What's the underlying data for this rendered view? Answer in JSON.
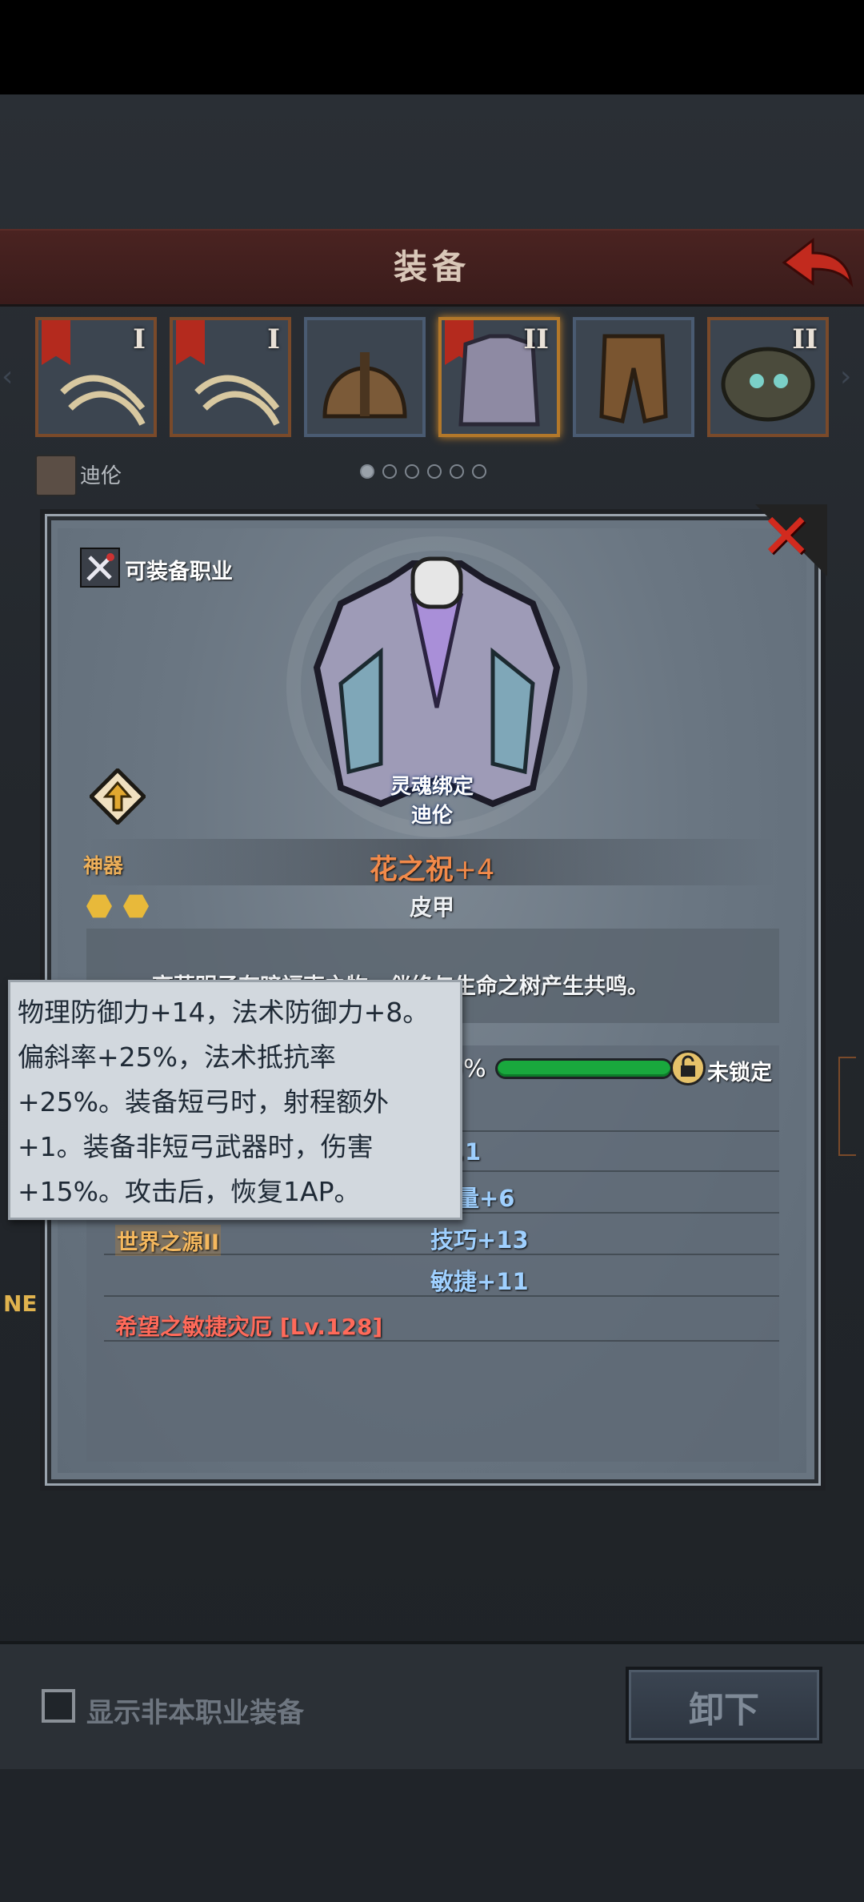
{
  "header": {
    "title": "装备"
  },
  "slots": [
    {
      "roman": "I",
      "name": "weapon-slot-1"
    },
    {
      "roman": "I",
      "name": "weapon-slot-2"
    },
    {
      "roman": "",
      "name": "helmet-slot"
    },
    {
      "roman": "II",
      "name": "armor-slot"
    },
    {
      "roman": "",
      "name": "legs-slot"
    },
    {
      "roman": "II",
      "name": "accessory-slot"
    }
  ],
  "character": {
    "name": "迪伦"
  },
  "pager": {
    "count": 6,
    "active": 0
  },
  "item": {
    "class_label": "可装备职业",
    "soulbound": "灵魂绑定",
    "soulbound_owner": "迪伦",
    "rarity": "神器",
    "name": "花之祝",
    "enhance": "+4",
    "type": "皮甲",
    "description": "高華明子有暗福東之物，伴终与生命之树产生共鸣。",
    "progress_text": "0%",
    "lock_status": "未锁定",
    "stats_partial": [
      ".1",
      "量+6"
    ],
    "set_name": "世界之源II",
    "stats": [
      "技巧+13",
      "敏捷+11"
    ],
    "curse": "希望之敏捷灾厄",
    "curse_level": "[Lv.128]"
  },
  "tooltip": {
    "lines": [
      "物理防御力+14，法术防御力+8。",
      "偏斜率+25%，法术抵抗率",
      "+25%。装备短弓时，射程额外",
      "+1。装备非短弓武器时，伤害",
      "+15%。攻击后，恢复1AP。"
    ]
  },
  "left_edge_text": "NE",
  "bottom": {
    "checkbox_label": "显示非本职业装备",
    "unequip_label": "卸下"
  },
  "colors": {
    "accent_orange": "#f28a4a",
    "stat_blue": "#9fd0ff",
    "curse_red": "#ff6a5a",
    "progress_green": "#19a83d",
    "close_red": "#d22a1e"
  }
}
